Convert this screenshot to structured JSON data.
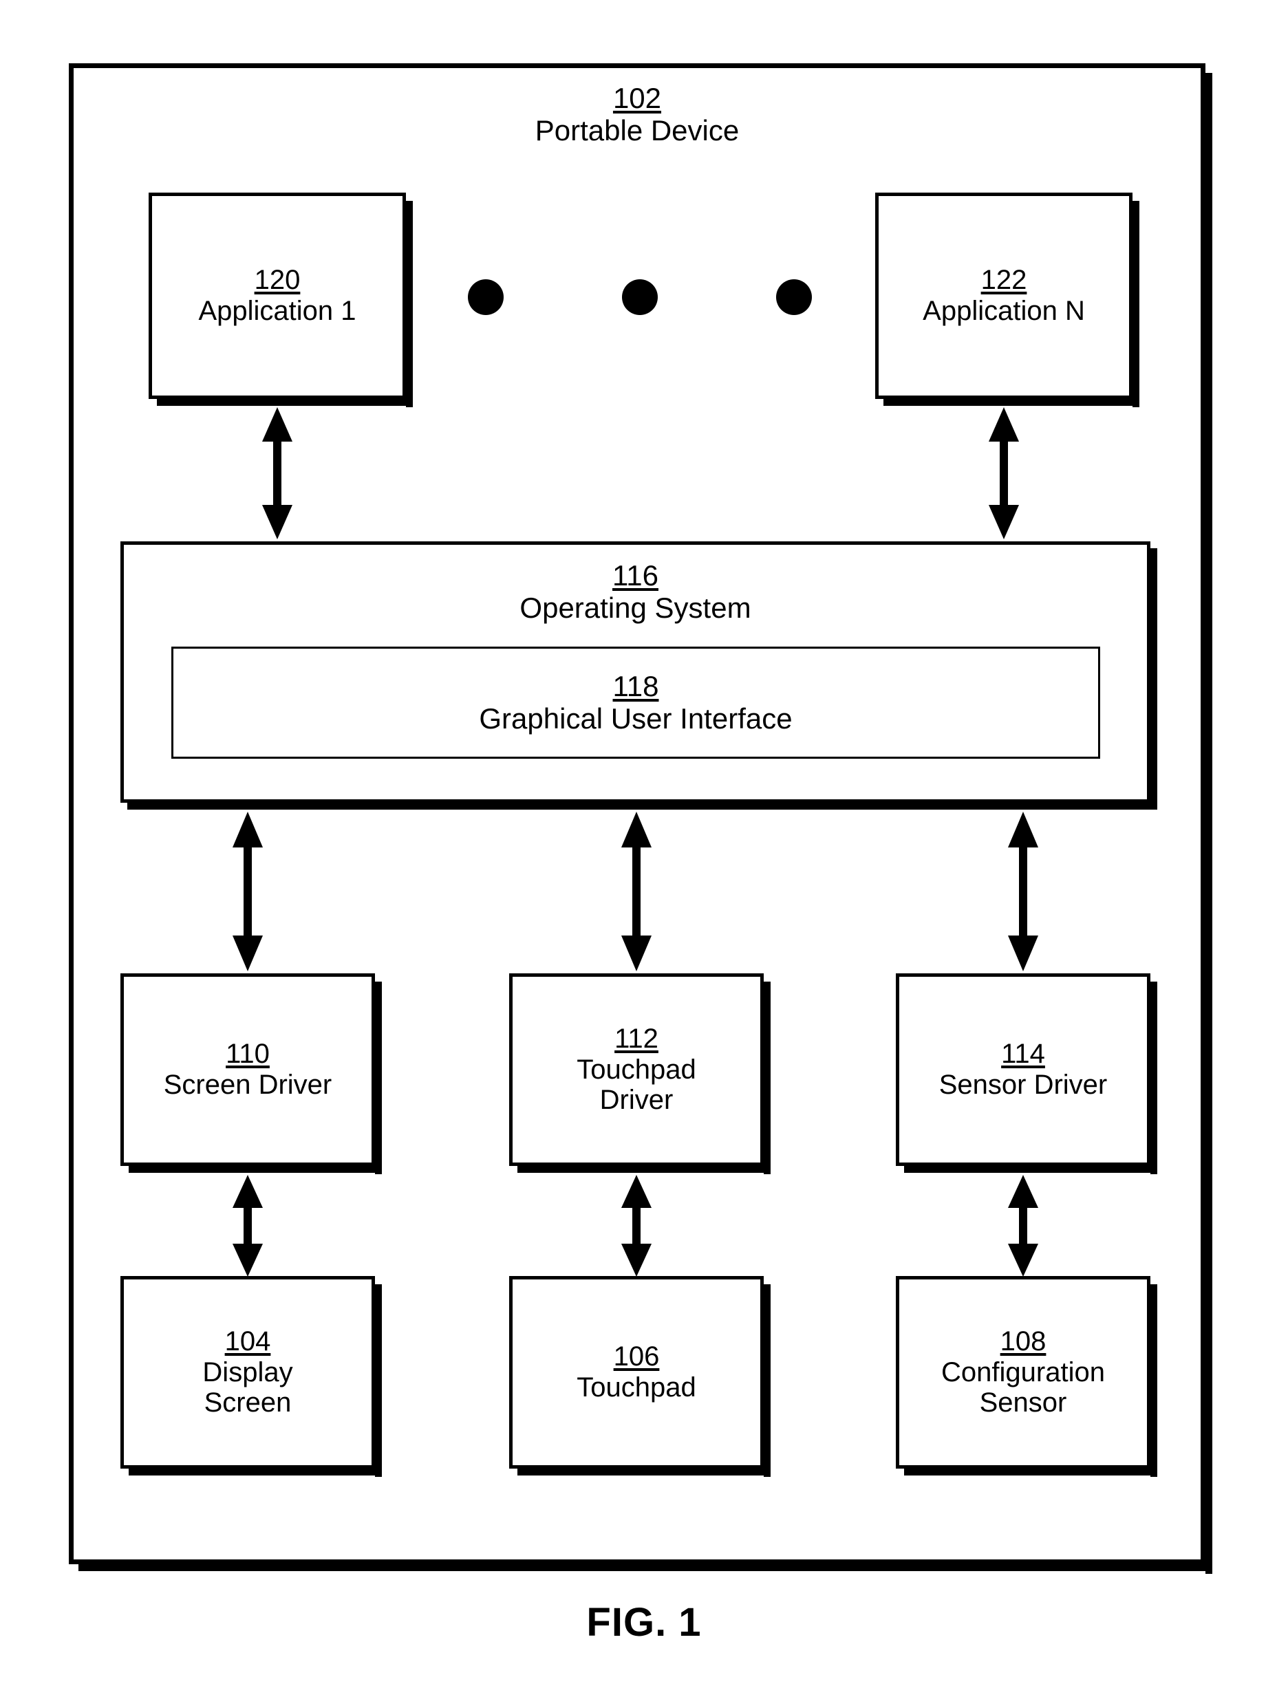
{
  "figure": {
    "caption": "FIG. 1"
  },
  "device": {
    "ref": "102",
    "label": "Portable Device"
  },
  "applications": [
    {
      "ref": "120",
      "label": "Application 1"
    },
    {
      "ref": "122",
      "label": "Application N"
    }
  ],
  "ellipsis": {
    "icon": "horizontal-ellipsis-dots",
    "count": 3
  },
  "operating_system": {
    "ref": "116",
    "label": "Operating System",
    "gui": {
      "ref": "118",
      "label": "Graphical User Interface"
    }
  },
  "drivers": [
    {
      "ref": "110",
      "label": "Screen Driver"
    },
    {
      "ref": "112",
      "label": "Touchpad\nDriver"
    },
    {
      "ref": "114",
      "label": "Sensor Driver"
    }
  ],
  "hardware": [
    {
      "ref": "104",
      "label": "Display\nScreen"
    },
    {
      "ref": "106",
      "label": "Touchpad"
    },
    {
      "ref": "108",
      "label": "Configuration\nSensor"
    }
  ],
  "connections": [
    {
      "id": "app1-to-os",
      "from": "120",
      "to": "116",
      "style": "double-headed-arrow"
    },
    {
      "id": "appn-to-os",
      "from": "122",
      "to": "116",
      "style": "double-headed-arrow"
    },
    {
      "id": "os-to-screen-driver",
      "from": "116",
      "to": "110",
      "style": "double-headed-arrow"
    },
    {
      "id": "os-to-touchpad-driver",
      "from": "116",
      "to": "112",
      "style": "double-headed-arrow"
    },
    {
      "id": "os-to-sensor-driver",
      "from": "116",
      "to": "114",
      "style": "double-headed-arrow"
    },
    {
      "id": "screen-driver-to-display",
      "from": "110",
      "to": "104",
      "style": "double-headed-arrow"
    },
    {
      "id": "touchpad-driver-to-touchpad",
      "from": "112",
      "to": "106",
      "style": "double-headed-arrow"
    },
    {
      "id": "sensor-driver-to-sensor",
      "from": "114",
      "to": "108",
      "style": "double-headed-arrow"
    }
  ],
  "colors": {
    "ink": "#000000",
    "paper": "#ffffff"
  }
}
